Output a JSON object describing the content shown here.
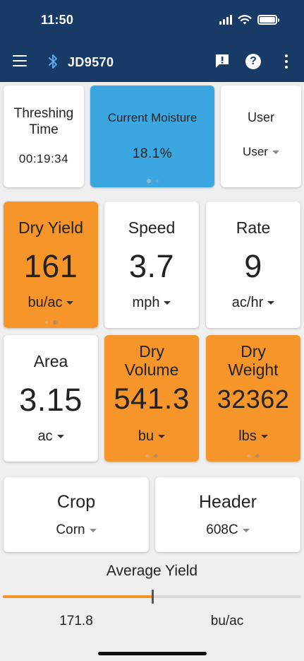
{
  "status_bar": {
    "time": "11:50"
  },
  "app_bar": {
    "device_name": "JD9570"
  },
  "threshing": {
    "title_line1": "Threshing",
    "title_line2": "Time",
    "value": "00:19:34"
  },
  "moisture": {
    "title": "Current Moisture",
    "value": "18.1%"
  },
  "user": {
    "title": "User",
    "value": "User"
  },
  "dry_yield": {
    "title": "Dry Yield",
    "value": "161",
    "unit": "bu/ac"
  },
  "speed": {
    "title": "Speed",
    "value": "3.7",
    "unit": "mph"
  },
  "rate": {
    "title": "Rate",
    "value": "9",
    "unit": "ac/hr"
  },
  "area": {
    "title": "Area",
    "value": "3.15",
    "unit": "ac"
  },
  "dry_volume": {
    "title_line1": "Dry",
    "title_line2": "Volume",
    "value": "541.3",
    "unit": "bu"
  },
  "dry_weight": {
    "title_line1": "Dry",
    "title_line2": "Weight",
    "value": "32362",
    "unit": "lbs"
  },
  "crop": {
    "title": "Crop",
    "value": "Corn"
  },
  "header": {
    "title": "Header",
    "value": "608C"
  },
  "average_yield": {
    "title": "Average Yield",
    "value": "171.8",
    "unit": "bu/ac",
    "slider_fraction": 0.5
  },
  "colors": {
    "app_bar": "#173a66",
    "accent_orange": "#f6962a",
    "accent_blue": "#3aa7e0",
    "background": "#efefef"
  },
  "icons": [
    "menu-icon",
    "bluetooth-icon",
    "alert-icon",
    "help-icon",
    "more-vert-icon",
    "signal-icon",
    "wifi-icon",
    "battery-icon"
  ]
}
